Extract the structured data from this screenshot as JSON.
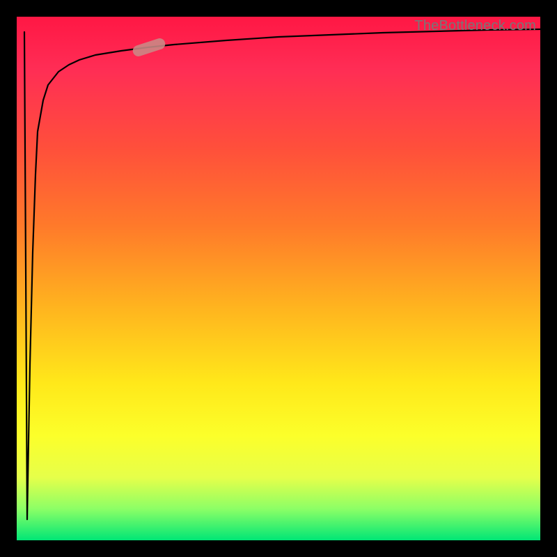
{
  "watermark": {
    "text": "TheBottleneck.com"
  },
  "colors": {
    "gradient_top": "#ff1744",
    "gradient_mid": "#ffe81a",
    "gradient_bottom": "#00e676",
    "curve": "#000000",
    "marker": "#c98a86",
    "frame": "#000000"
  },
  "chart_data": {
    "type": "line",
    "title": "",
    "xlabel": "",
    "ylabel": "",
    "xlim": [
      0,
      100
    ],
    "ylim": [
      0,
      100
    ],
    "grid": false,
    "legend": false,
    "note": "Axes are unlabeled in the image; values below are read from pixel positions relative to plot extent and rounded.",
    "series": [
      {
        "name": "curve",
        "x": [
          2,
          2.5,
          3,
          3.5,
          4,
          5,
          6,
          8,
          10,
          12,
          15,
          20,
          25,
          30,
          40,
          50,
          60,
          70,
          80,
          90,
          100
        ],
        "y": [
          4,
          30,
          55,
          70,
          78,
          84,
          87,
          89.5,
          91,
          91.8,
          92.6,
          93.5,
          94.2,
          94.7,
          95.5,
          96.1,
          96.5,
          96.9,
          97.2,
          97.4,
          97.6
        ]
      },
      {
        "name": "initial-drop",
        "x": [
          1.5,
          1.8,
          2
        ],
        "y": [
          97,
          50,
          4
        ]
      }
    ],
    "annotations": [
      {
        "name": "marker",
        "shape": "pill",
        "approx_x": 25,
        "approx_y": 94,
        "angle_deg": -18,
        "color": "#c98a86"
      }
    ]
  }
}
